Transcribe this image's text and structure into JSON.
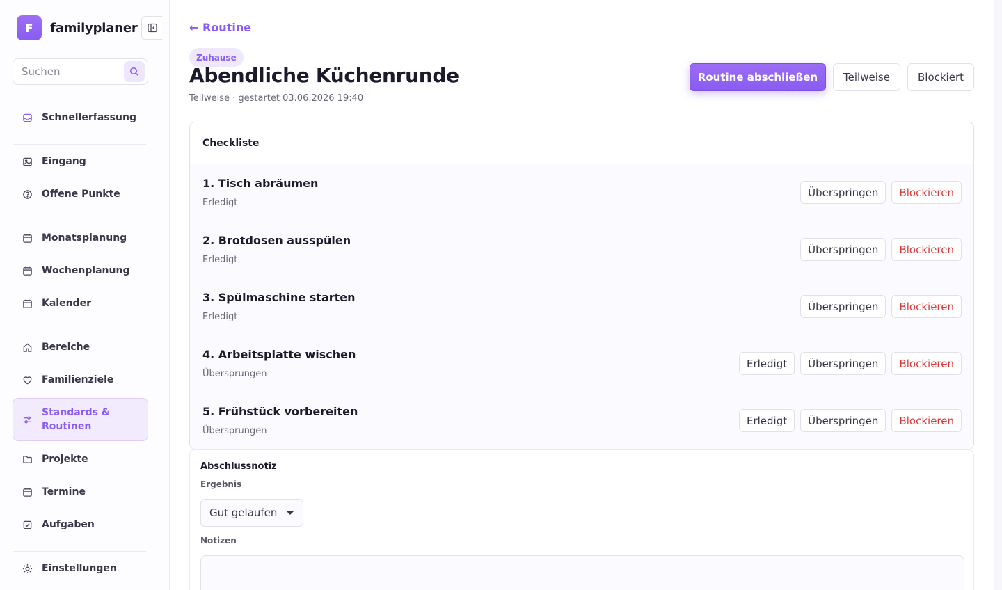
{
  "brand": {
    "logo_letter": "F",
    "name": "familyplaner"
  },
  "search": {
    "placeholder": "Suchen"
  },
  "sidebar": {
    "items": [
      {
        "label": "Schnellerfassung",
        "icon": "inbox-icon"
      },
      {
        "label": "Eingang",
        "icon": "image-icon"
      },
      {
        "label": "Offene Punkte",
        "icon": "question-circle-icon"
      },
      {
        "label": "Monatsplanung",
        "icon": "calendar-icon"
      },
      {
        "label": "Wochenplanung",
        "icon": "calendar-icon"
      },
      {
        "label": "Kalender",
        "icon": "calendar-icon"
      },
      {
        "label": "Bereiche",
        "icon": "home-icon"
      },
      {
        "label": "Familienziele",
        "icon": "heart-icon"
      },
      {
        "label": "Standards & Routinen",
        "icon": "sliders-icon",
        "active": true
      },
      {
        "label": "Projekte",
        "icon": "folder-icon"
      },
      {
        "label": "Termine",
        "icon": "calendar-icon"
      },
      {
        "label": "Aufgaben",
        "icon": "checkbox-icon"
      },
      {
        "label": "Einstellungen",
        "icon": "sun-gear-icon"
      }
    ]
  },
  "header": {
    "back_label": "← Routine",
    "chip": "Zuhause",
    "title": "Abendliche Küchenrunde",
    "subtitle": "Teilweise · gestartet 03.06.2026 19:40",
    "actions": {
      "complete": "Routine abschließen",
      "partial": "Teilweise",
      "blocked": "Blockiert"
    }
  },
  "checklist": {
    "heading": "Checkliste",
    "items": [
      {
        "title": "1. Tisch abräumen",
        "status": "Erledigt",
        "actions": [
          "Überspringen",
          "Blockieren"
        ]
      },
      {
        "title": "2. Brotdosen ausspülen",
        "status": "Erledigt",
        "actions": [
          "Überspringen",
          "Blockieren"
        ]
      },
      {
        "title": "3. Spülmaschine starten",
        "status": "Erledigt",
        "actions": [
          "Überspringen",
          "Blockieren"
        ]
      },
      {
        "title": "4. Arbeitsplatte wischen",
        "status": "Übersprungen",
        "actions": [
          "Erledigt",
          "Überspringen",
          "Blockieren"
        ]
      },
      {
        "title": "5. Frühstück vorbereiten",
        "status": "Übersprungen",
        "actions": [
          "Erledigt",
          "Überspringen",
          "Blockieren"
        ]
      }
    ]
  },
  "note": {
    "title": "Abschlussnotiz",
    "result_label": "Ergebnis",
    "result_value": "Gut gelaufen",
    "notes_label": "Notizen",
    "notes_value": ""
  },
  "colors": {
    "accent": "#8a5cf0",
    "danger": "#d63a3a",
    "active_bg": "#f1ebfd"
  }
}
